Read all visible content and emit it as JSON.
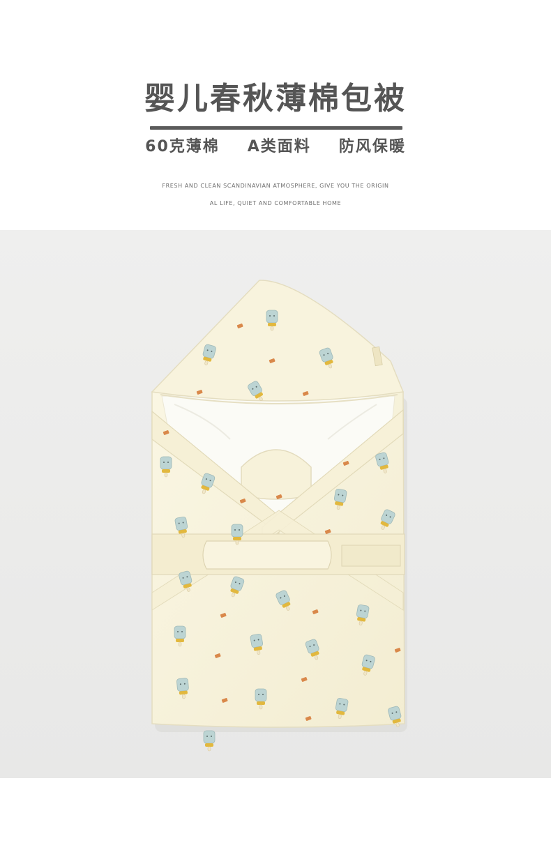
{
  "header": {
    "title": "婴儿春秋薄棉包被",
    "features": [
      "60克薄棉",
      "A类面料",
      "防风保暖"
    ],
    "tagline_lines": [
      "FRESH AND CLEAN SCANDINAVIAN ATMOSPHERE, GIVE YOU THE ORIGIN",
      "AL LIFE, QUIET AND COMFORTABLE HOME"
    ]
  },
  "product_image": {
    "subject": "product-photo",
    "colors": {
      "backdrop": "#ececeb",
      "fabric": "#f8f3dd",
      "fabric_shadow": "#ece5c8",
      "lining": "#fbfbf6",
      "print_bottle": "#bcd4d3",
      "print_cap": "#e2b83e",
      "print_accent": "#d9884a"
    }
  }
}
